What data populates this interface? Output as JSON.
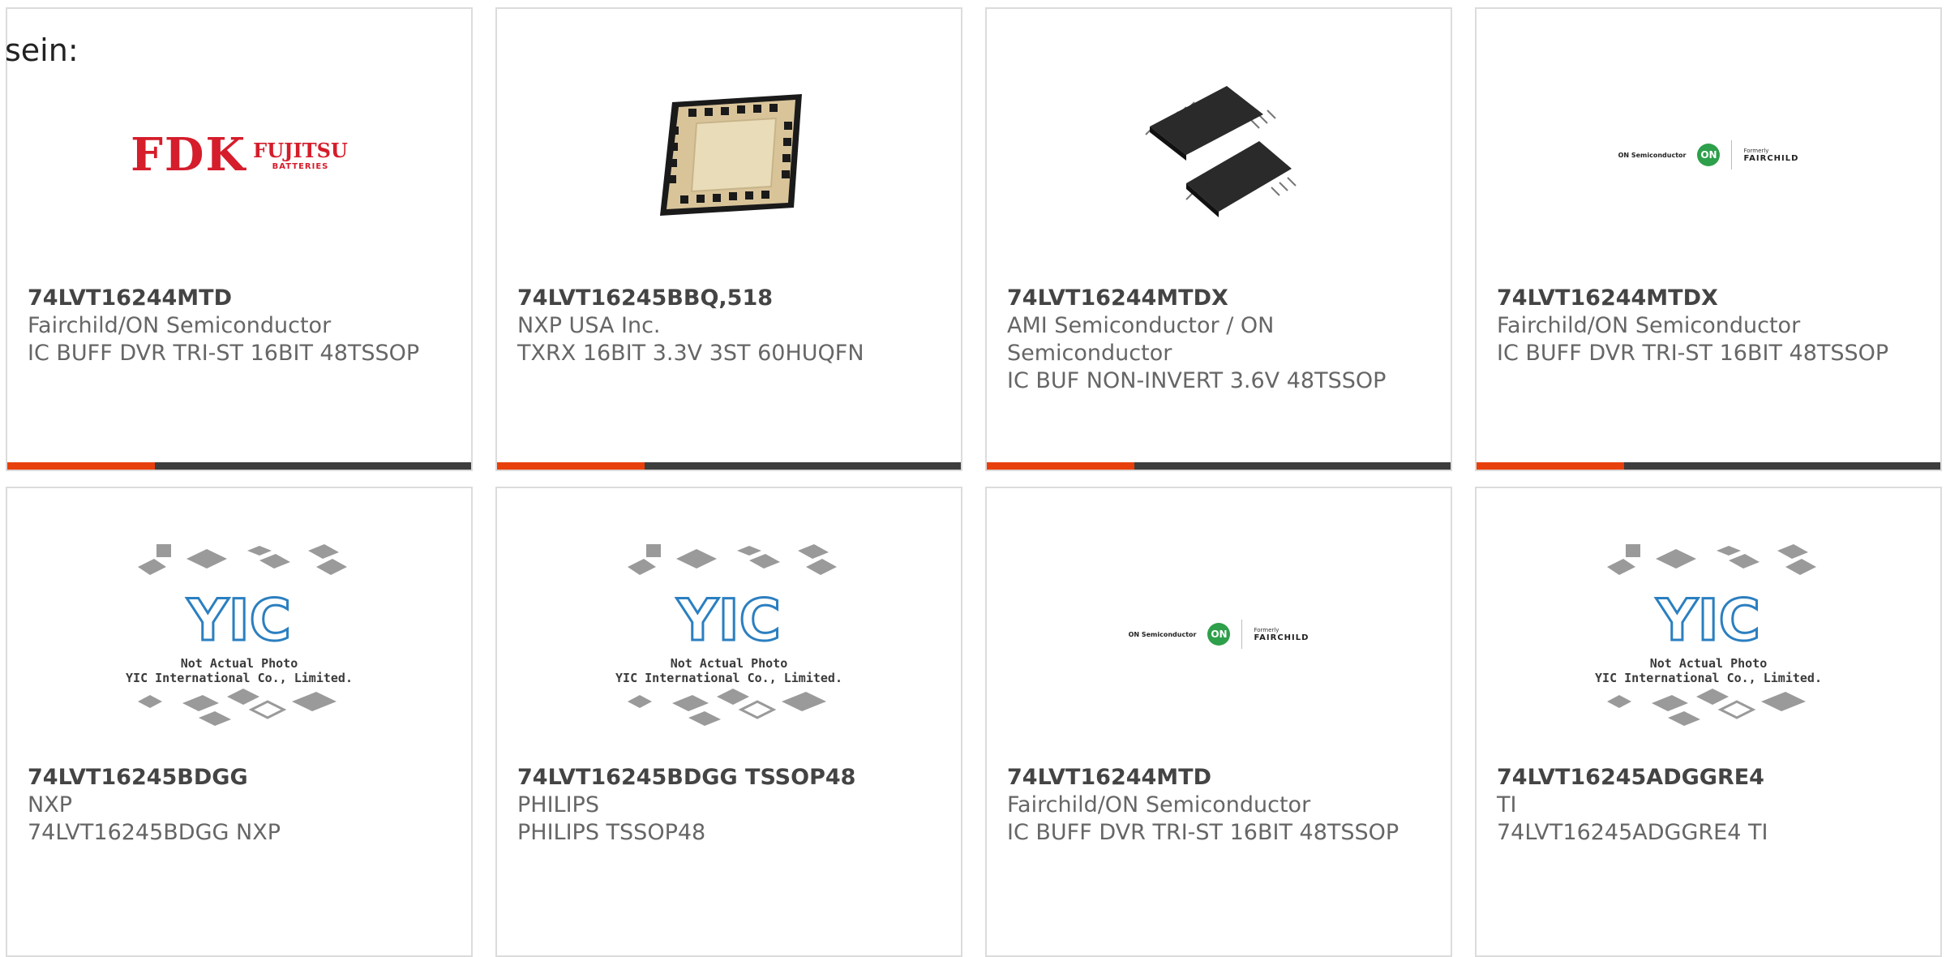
{
  "page": {
    "heading": "sein:"
  },
  "colors": {
    "accent": "#e8400c",
    "bar": "#3d3d3d",
    "yic_blue": "#2b7fc0"
  },
  "products": [
    {
      "part": "74LVT16244MTD",
      "manufacturer": "Fairchild/ON Semiconductor",
      "description": "IC BUFF DVR TRI-ST 16BIT 48TSSOP",
      "image": "fdk-fujitsu-logo",
      "logo": {
        "main": "FDK",
        "side": "FUJITSU",
        "sub": "BATTERIES"
      }
    },
    {
      "part": "74LVT16245BBQ,518",
      "manufacturer": "NXP USA Inc.",
      "description": "TXRX 16BIT 3.3V 3ST 60HUQFN",
      "image": "qfn-chip-photo"
    },
    {
      "part": "74LVT16244MTDX",
      "manufacturer": "AMI Semiconductor / ON Semiconductor",
      "description": "IC BUF NON-INVERT 3.6V 48TSSOP",
      "image": "tssop-chips-photo"
    },
    {
      "part": "74LVT16244MTDX",
      "manufacturer": "Fairchild/ON Semiconductor",
      "description": "IC BUFF DVR TRI-ST 16BIT 48TSSOP",
      "image": "on-fairchild-logo",
      "logo": {
        "left": "ON Semiconductor",
        "circle": "ON",
        "formerly": "Formerly",
        "brand": "FAIRCHILD"
      }
    },
    {
      "part": "74LVT16245BDGG",
      "manufacturer": "NXP",
      "description": "74LVT16245BDGG NXP",
      "image": "yic-placeholder",
      "placeholder": {
        "brand": "YIC",
        "line1": "Not Actual Photo",
        "line2": "YIC International Co., Limited."
      }
    },
    {
      "part": "74LVT16245BDGG TSSOP48",
      "manufacturer": "PHILIPS",
      "description": "PHILIPS TSSOP48",
      "image": "yic-placeholder",
      "placeholder": {
        "brand": "YIC",
        "line1": "Not Actual Photo",
        "line2": "YIC International Co., Limited."
      }
    },
    {
      "part": "74LVT16244MTD",
      "manufacturer": "Fairchild/ON Semiconductor",
      "description": "IC BUFF DVR TRI-ST 16BIT 48TSSOP",
      "image": "on-fairchild-logo",
      "logo": {
        "left": "ON Semiconductor",
        "circle": "ON",
        "formerly": "Formerly",
        "brand": "FAIRCHILD"
      }
    },
    {
      "part": "74LVT16245ADGGRE4",
      "manufacturer": "TI",
      "description": "74LVT16245ADGGRE4 TI",
      "image": "yic-placeholder",
      "placeholder": {
        "brand": "YIC",
        "line1": "Not Actual Photo",
        "line2": "YIC International Co., Limited."
      }
    }
  ]
}
